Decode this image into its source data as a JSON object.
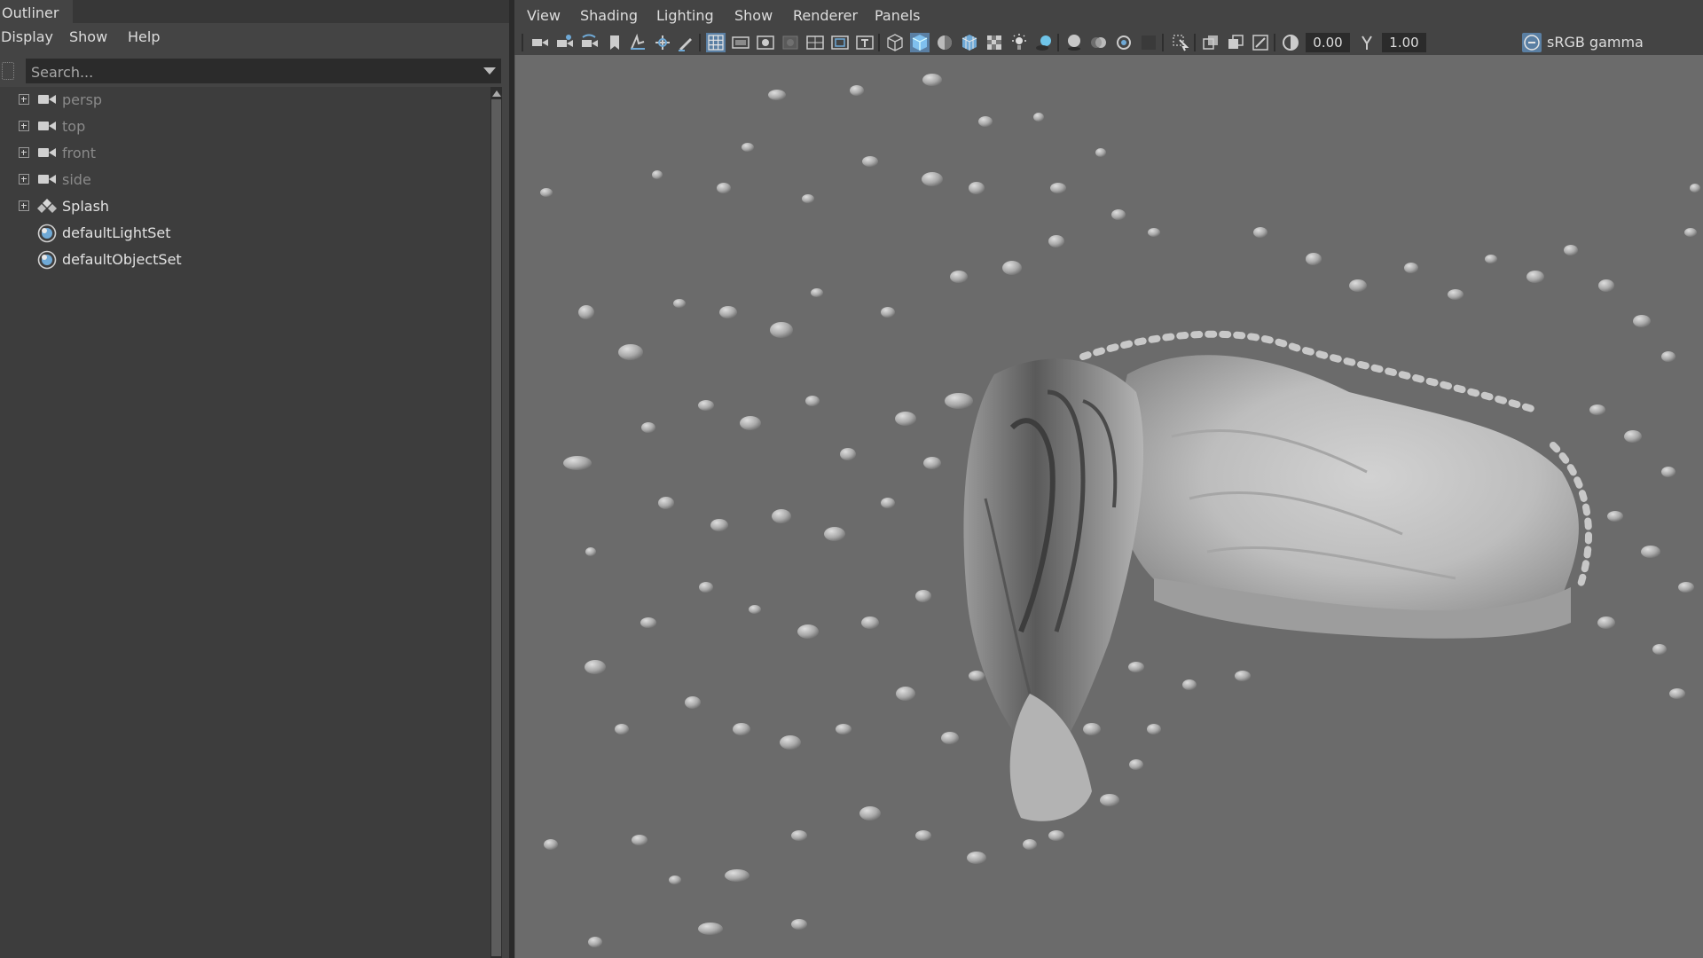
{
  "outliner": {
    "title": "Outliner",
    "menu": [
      "Display",
      "Show",
      "Help"
    ],
    "search": {
      "placeholder": "Search..."
    },
    "items": [
      {
        "label": "persp",
        "icon": "camera-icon",
        "expandable": true,
        "dim": true
      },
      {
        "label": "top",
        "icon": "camera-icon",
        "expandable": true,
        "dim": true
      },
      {
        "label": "front",
        "icon": "camera-icon",
        "expandable": true,
        "dim": true
      },
      {
        "label": "side",
        "icon": "camera-icon",
        "expandable": true,
        "dim": true
      },
      {
        "label": "Splash",
        "icon": "transform-icon",
        "expandable": true,
        "dim": false
      },
      {
        "label": "defaultLightSet",
        "icon": "object-set-icon",
        "expandable": false,
        "dim": false
      },
      {
        "label": "defaultObjectSet",
        "icon": "object-set-icon",
        "expandable": false,
        "dim": false
      }
    ]
  },
  "viewport": {
    "menu": [
      "View",
      "Shading",
      "Lighting",
      "Show",
      "Renderer",
      "Panels"
    ],
    "toolbar": {
      "exposure_value": "0.00",
      "gamma_value": "1.00",
      "color_space": "sRGB gamma"
    },
    "scene_object": "fluid splash mesh"
  },
  "colors": {
    "panel_bg": "#444444",
    "viewport_bg": "#6b6b6b",
    "accent_blue": "#5a9fd4",
    "mesh_light": "#c9c9c9",
    "mesh_dark": "#3f3f3f"
  }
}
